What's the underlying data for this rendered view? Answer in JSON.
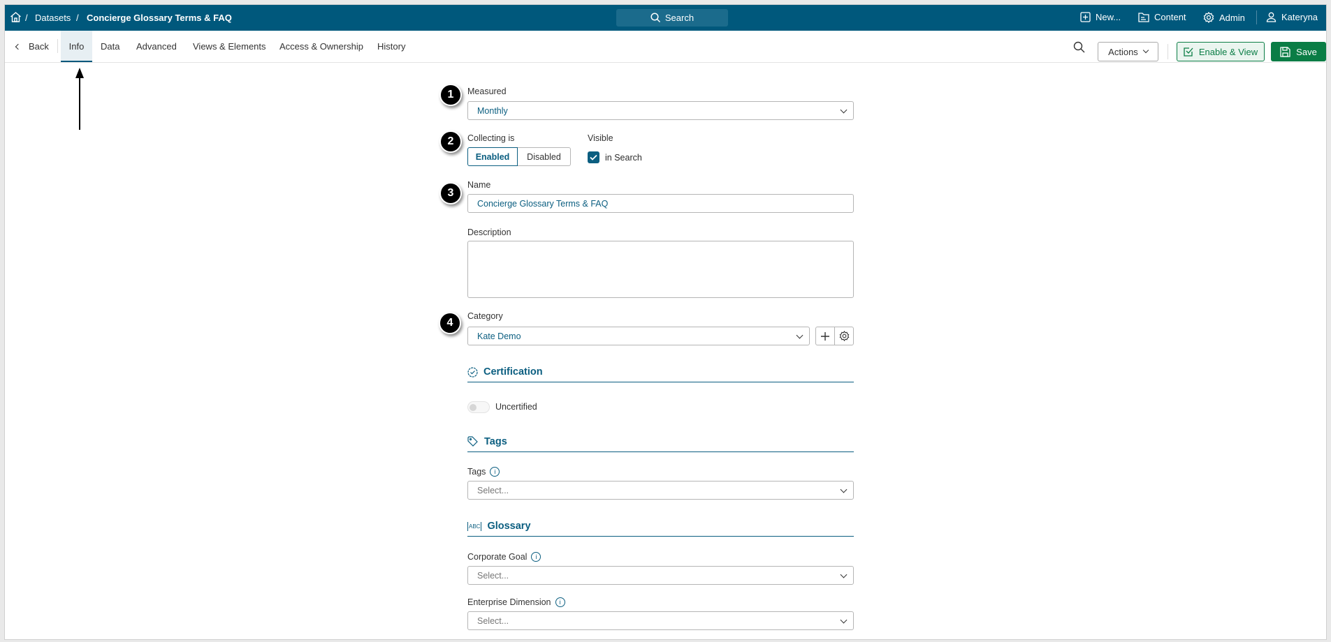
{
  "header": {
    "breadcrumb": [
      "Datasets",
      "Concierge Glossary Terms & FAQ"
    ],
    "search_label": "Search",
    "new_label": "New...",
    "content_label": "Content",
    "admin_label": "Admin",
    "user_label": "Kateryna"
  },
  "tabs": {
    "back": "Back",
    "items": [
      "Info",
      "Data",
      "Advanced",
      "Views & Elements",
      "Access & Ownership",
      "History"
    ],
    "active": "Info"
  },
  "toolbar": {
    "actions_label": "Actions",
    "enable_view_label": "Enable & View",
    "save_label": "Save"
  },
  "badges": [
    "1",
    "2",
    "3",
    "4"
  ],
  "form": {
    "measured_label": "Measured",
    "measured_value": "Monthly",
    "collecting_label": "Collecting is",
    "collecting_options": [
      "Enabled",
      "Disabled"
    ],
    "collecting_selected": "Enabled",
    "visible_label": "Visible",
    "visible_checkbox_label": "in Search",
    "visible_checked": true,
    "name_label": "Name",
    "name_value": "Concierge Glossary Terms & FAQ",
    "description_label": "Description",
    "description_value": "",
    "category_label": "Category",
    "category_value": "Kate Demo",
    "certification_heading": "Certification",
    "certification_status": "Uncertified",
    "tags_heading": "Tags",
    "tags_label": "Tags",
    "tags_placeholder": "Select...",
    "glossary_heading": "Glossary",
    "glossary_icon_text": "ABC",
    "corporate_goal_label": "Corporate Goal",
    "corporate_goal_placeholder": "Select...",
    "enterprise_dimension_label": "Enterprise Dimension",
    "enterprise_dimension_placeholder": "Select..."
  },
  "colors": {
    "brand": "#00587c",
    "accent": "#0b5e80",
    "save": "#0a7d45"
  }
}
